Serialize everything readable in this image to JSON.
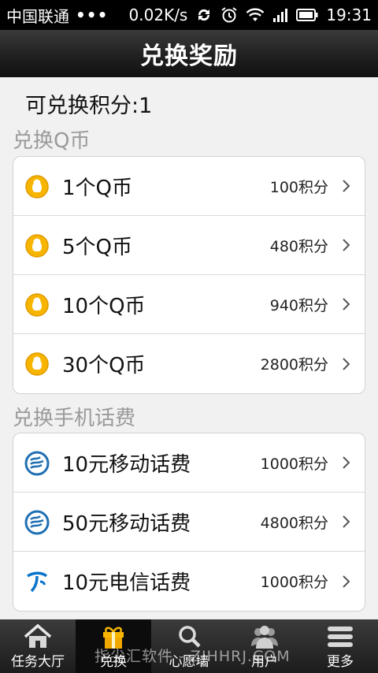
{
  "status_bar": {
    "carrier": "中国联通",
    "dots": "•••",
    "speed": "0.02K/s",
    "time": "19:31"
  },
  "header": {
    "title": "兑换奖励"
  },
  "points_label": "可兑换积分:1",
  "sections": [
    {
      "label": "兑换Q币",
      "items": [
        {
          "title": "1个Q币",
          "cost": "100积分",
          "icon": "qq-penguin-icon"
        },
        {
          "title": "5个Q币",
          "cost": "480积分",
          "icon": "qq-penguin-icon"
        },
        {
          "title": "10个Q币",
          "cost": "940积分",
          "icon": "qq-penguin-icon"
        },
        {
          "title": "30个Q币",
          "cost": "2800积分",
          "icon": "qq-penguin-icon"
        }
      ]
    },
    {
      "label": "兑换手机话费",
      "items": [
        {
          "title": "10元移动话费",
          "cost": "1000积分",
          "icon": "china-mobile-icon"
        },
        {
          "title": "50元移动话费",
          "cost": "4800积分",
          "icon": "china-mobile-icon"
        },
        {
          "title": "10元电信话费",
          "cost": "1000积分",
          "icon": "china-telecom-icon"
        }
      ]
    }
  ],
  "nav": [
    {
      "label": "任务大厅",
      "icon": "home-icon",
      "active": false
    },
    {
      "label": "兑换",
      "icon": "gift-icon",
      "active": true
    },
    {
      "label": "心愿墙",
      "icon": "search-icon",
      "active": false
    },
    {
      "label": "用户",
      "icon": "users-icon",
      "active": false
    },
    {
      "label": "更多",
      "icon": "menu-icon",
      "active": false
    }
  ],
  "watermark": "指尖汇软件 - ZJHHRJ.COM",
  "colors": {
    "accent_orange": "#f7b500",
    "mobile_blue": "#1f6fb3",
    "telecom_blue": "#0a74c9",
    "section_gray": "#9a9a9a"
  }
}
